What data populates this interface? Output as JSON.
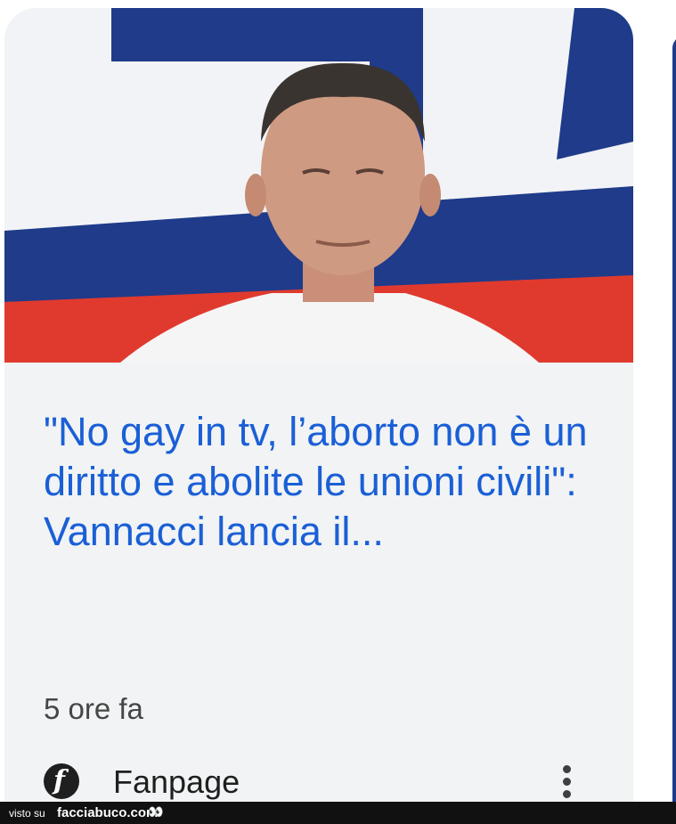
{
  "article": {
    "title": "\"No gay in tv, l’aborto non è un diritto e abolite le unioni civili\": Vannacci lancia il...",
    "time": "5 ore fa",
    "source": "Fanpage",
    "source_logo_letter": "f"
  },
  "footer": {
    "seen_on": "visto su",
    "brand": "facciabuco.com",
    "eyes": "👀"
  },
  "colors": {
    "title": "#1a5fd6",
    "card_bg": "#f1f3f4",
    "photo_bg_blue": "#1f3b8a",
    "photo_bg_red": "#e03a2e"
  },
  "icons": {
    "menu": "more-vert-icon",
    "source_logo": "fanpage-logo-icon"
  }
}
